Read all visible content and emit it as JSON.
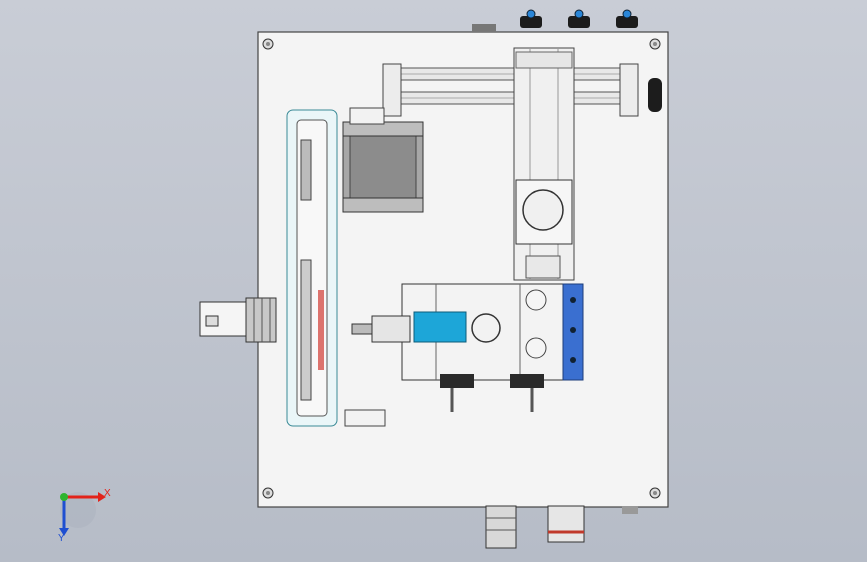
{
  "viewport": {
    "background_top": "#c9cdd6",
    "background_bottom": "#b6bcc7"
  },
  "triad": {
    "x_label": "X",
    "y_label": "Y",
    "x_color": "#e2231a",
    "y_color": "#1f4fd1",
    "z_color": "#2fb52f"
  },
  "model": {
    "plate_color": "#f4f4f4",
    "accent_blue": "#1da6d8",
    "bracket_blue": "#3a6fd0",
    "belt_red": "#d03a32"
  }
}
